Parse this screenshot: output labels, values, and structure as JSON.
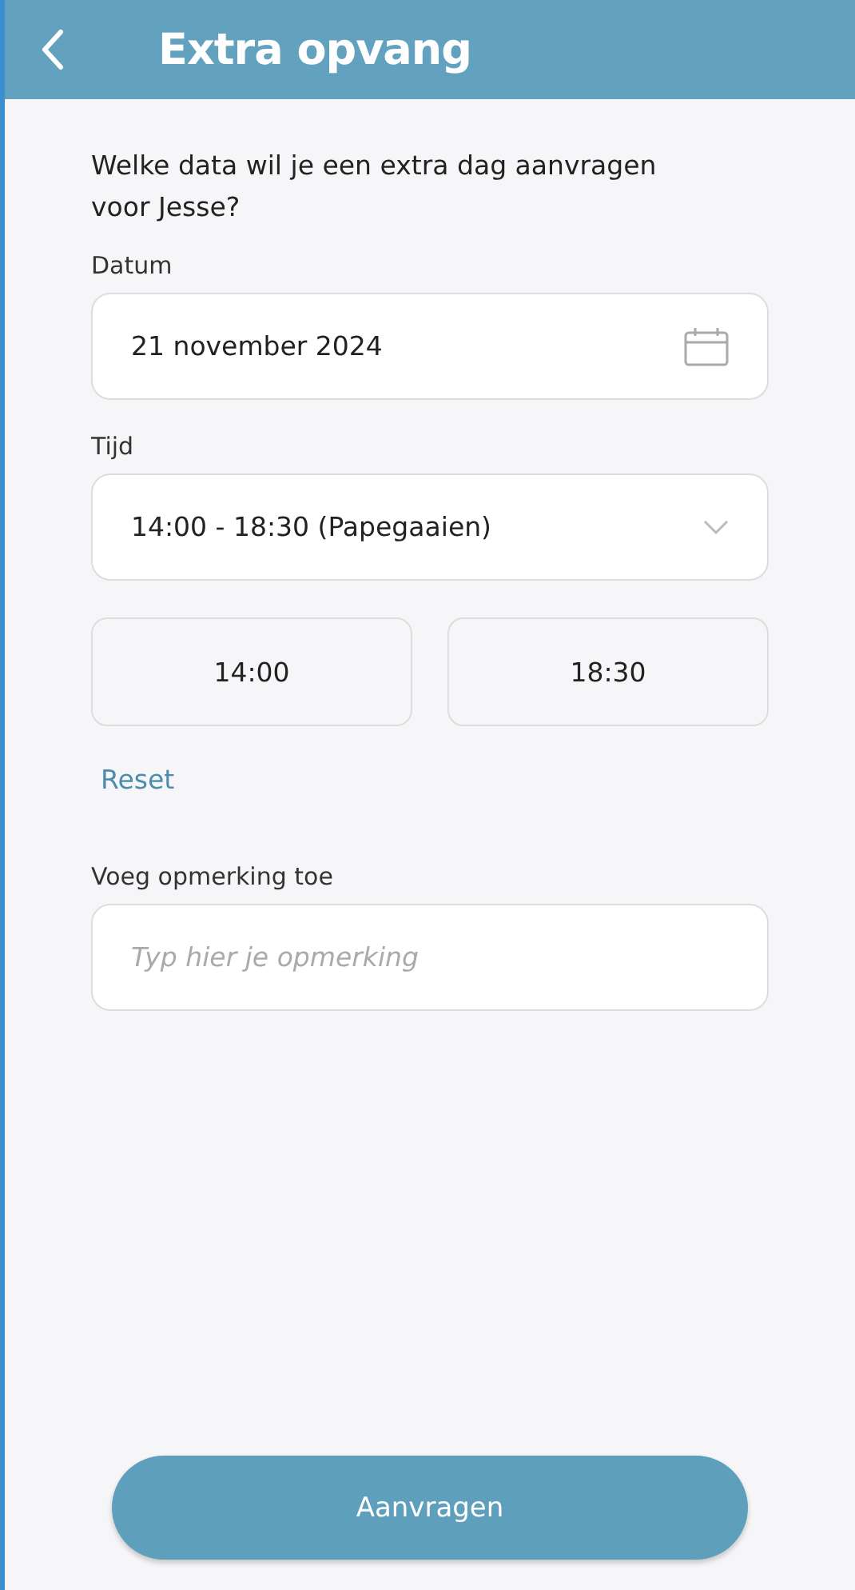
{
  "header": {
    "title": "Extra opvang"
  },
  "question": "Welke data wil je een extra dag aanvragen voor Jesse?",
  "date": {
    "label": "Datum",
    "value": "21 november 2024"
  },
  "time": {
    "label": "Tijd",
    "value": "14:00 - 18:30 (Papegaaien)"
  },
  "times": [
    "14:00",
    "18:30"
  ],
  "reset": "Reset",
  "remark": {
    "label": "Voeg opmerking toe",
    "placeholder": "Typ hier je opmerking"
  },
  "submit": "Aanvragen"
}
